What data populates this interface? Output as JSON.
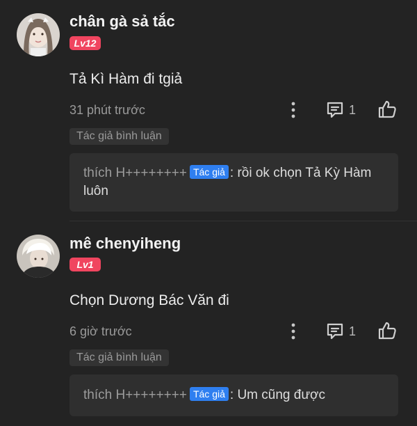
{
  "comments": [
    {
      "username": "chân gà sả tắc",
      "level": "Lv12",
      "text": "Tả Kì Hàm đi tgiả",
      "time": "31 phút trước",
      "reply_count": "1",
      "author_tag": "Tác giả bình luận",
      "reply": {
        "user": "thích H++++++++",
        "badge": "Tác giả",
        "text": ": rồi ok chọn Tả Kỳ Hàm luôn"
      }
    },
    {
      "username": "mê chenyiheng",
      "level": "Lv1",
      "text": "Chọn Dương Bác Văn đi",
      "time": "6 giờ trước",
      "reply_count": "1",
      "author_tag": "Tác giả bình luận",
      "reply": {
        "user": "thích H++++++++",
        "badge": "Tác giả",
        "text": ": Um cũng được"
      }
    }
  ],
  "colors": {
    "background": "#232323",
    "level_badge": "#f0455f",
    "author_badge": "#2f7ff0",
    "reply_box": "#2f2f2f"
  },
  "icons": {
    "more": "more-vertical-icon",
    "reply": "comment-icon",
    "like": "thumbs-up-icon"
  }
}
